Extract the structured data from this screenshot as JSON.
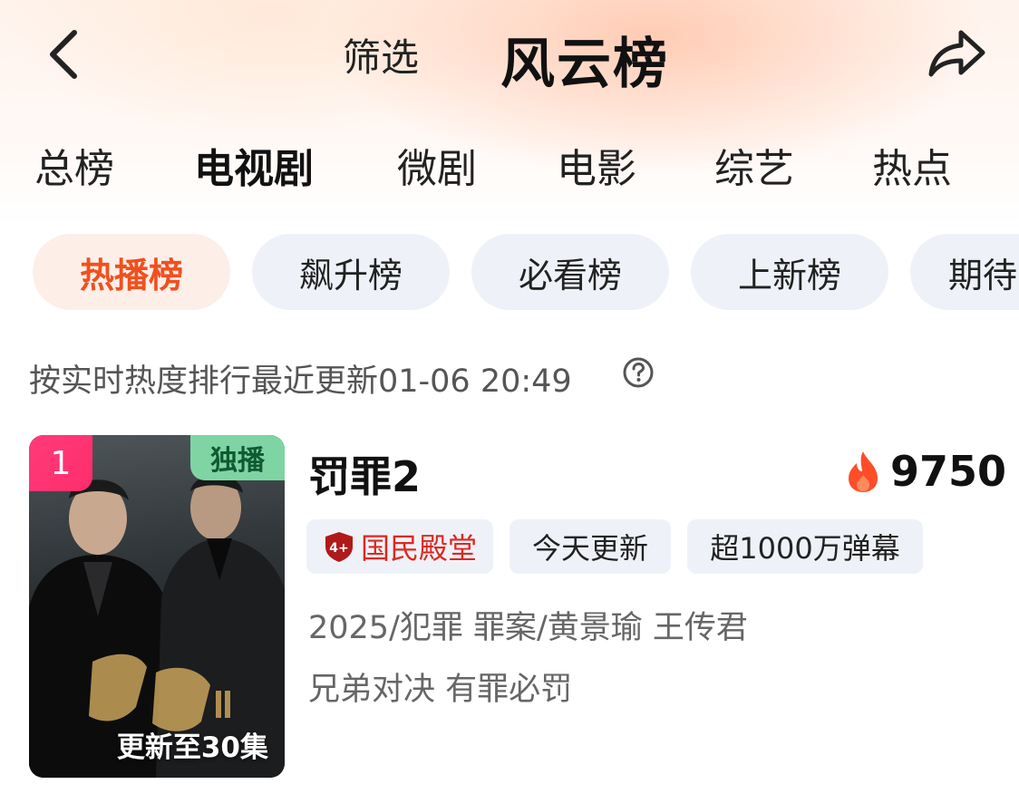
{
  "header": {
    "filter_label": "筛选",
    "title": "风云榜"
  },
  "category_tabs": [
    {
      "label": "总榜",
      "active": false
    },
    {
      "label": "电视剧",
      "active": true
    },
    {
      "label": "微剧",
      "active": false
    },
    {
      "label": "电影",
      "active": false
    },
    {
      "label": "综艺",
      "active": false
    },
    {
      "label": "热点",
      "active": false
    }
  ],
  "sub_tabs": [
    {
      "label": "热播榜",
      "active": true
    },
    {
      "label": "飙升榜",
      "active": false
    },
    {
      "label": "必看榜",
      "active": false
    },
    {
      "label": "上新榜",
      "active": false
    },
    {
      "label": "期待",
      "active": false
    }
  ],
  "rank_info": "按实时热度排行最近更新01-06 20:49",
  "items": [
    {
      "rank": "1",
      "exclusive_label": "独播",
      "poster_caption": "更新至30集",
      "title": "罚罪2",
      "heat": "9750",
      "tags": [
        "国民殿堂",
        "今天更新",
        "超1000万弹幕"
      ],
      "meta": "2025/犯罪 罪案/黄景瑜 王传君",
      "slogan": "兄弟对决 有罪必罚"
    }
  ],
  "colors": {
    "accent": "#f0501e",
    "rank_badge": "#ff2d6b",
    "exclusive_badge": "#7fd4a4",
    "chip_bg": "#eef2f8",
    "honor_red": "#e0261f"
  },
  "icons": {
    "back": "chevron-left-icon",
    "share": "share-arrow-icon",
    "help": "question-circle-icon",
    "heat": "fire-icon",
    "honor": "shield-badge-icon"
  }
}
